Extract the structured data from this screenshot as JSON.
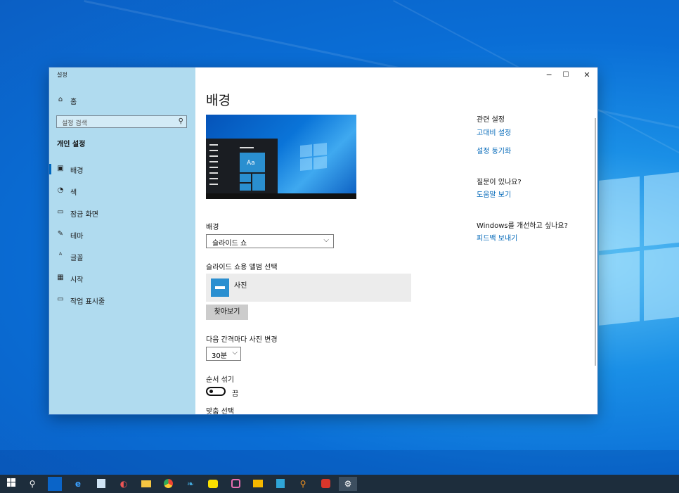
{
  "window": {
    "title": "설정",
    "controls": {
      "minimize": "─",
      "maximize": "☐",
      "close": "✕"
    }
  },
  "sidebar": {
    "home": "홈",
    "search_placeholder": "설정 검색",
    "section": "개인 설정",
    "items": [
      {
        "label": "배경",
        "icon": "picture-icon"
      },
      {
        "label": "색",
        "icon": "palette-icon"
      },
      {
        "label": "잠금 화면",
        "icon": "lock-screen-icon"
      },
      {
        "label": "테마",
        "icon": "theme-icon"
      },
      {
        "label": "글꼴",
        "icon": "font-icon"
      },
      {
        "label": "시작",
        "icon": "start-icon"
      },
      {
        "label": "작업 표시줄",
        "icon": "taskbar-icon"
      }
    ]
  },
  "main": {
    "title": "배경",
    "preview_sample": "Aa",
    "background_label": "배경",
    "background_value": "슬라이드 쇼",
    "album_label": "슬라이드 쇼용 앨범 선택",
    "album_name": "사진",
    "browse_button": "찾아보기",
    "interval_label": "다음 간격마다 사진 변경",
    "interval_value": "30분",
    "shuffle_label": "순서 섞기",
    "shuffle_state": "끔",
    "fit_label": "맞춤 선택"
  },
  "related": {
    "heading": "관련 설정",
    "links": [
      "고대비 설정",
      "설정 동기화"
    ],
    "question": "질문이 있나요?",
    "help_link": "도움말 보기",
    "improve": "Windows를 개선하고 싶나요?",
    "feedback_link": "피드백 보내기"
  },
  "taskbar": {
    "icons": [
      "start-icon",
      "search-icon",
      "outlook-icon",
      "edge-icon",
      "notepad-icon",
      "app-icon",
      "file-explorer-icon",
      "chrome-icon",
      "bird-icon",
      "kakaotalk-icon",
      "chat-icon",
      "slides-icon",
      "app2-icon",
      "search-app-icon",
      "photo-icon",
      "settings-icon"
    ]
  },
  "colors": {
    "accent": "#0067b8",
    "sidebar": "#b0dbef",
    "taskbar": "#1d2d3c"
  }
}
